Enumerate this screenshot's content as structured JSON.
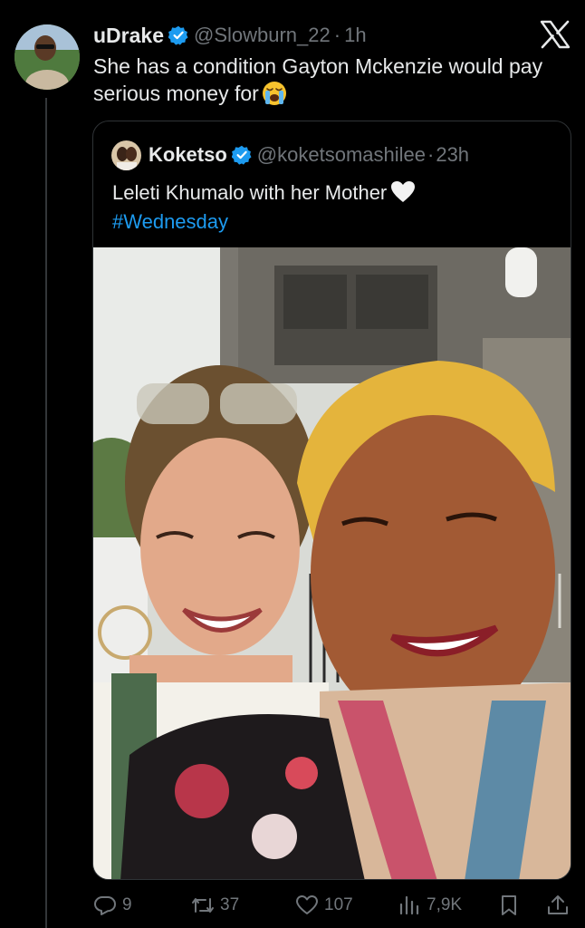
{
  "tweet": {
    "author_name": "uDrake",
    "author_handle": "@Slowburn_22",
    "time": "1h",
    "text": "She has a condition Gayton Mckenzie would pay serious money for",
    "emoji": "loudly-crying-face"
  },
  "quoted_tweet": {
    "author_name": "Koketso",
    "author_handle": "@koketsomashilee",
    "time": "23h",
    "text": "Leleti Khumalo with her Mother",
    "emoji": "white-heart",
    "hashtag": "#Wednesday"
  },
  "actions": {
    "replies": "9",
    "retweets": "37",
    "likes": "107",
    "views": "7,9K"
  },
  "colors": {
    "background": "#000000",
    "text": "#e7e9ea",
    "muted": "#71767b",
    "link": "#1d9bf0",
    "verified": "#1d9bf0",
    "border": "#2f3336"
  }
}
